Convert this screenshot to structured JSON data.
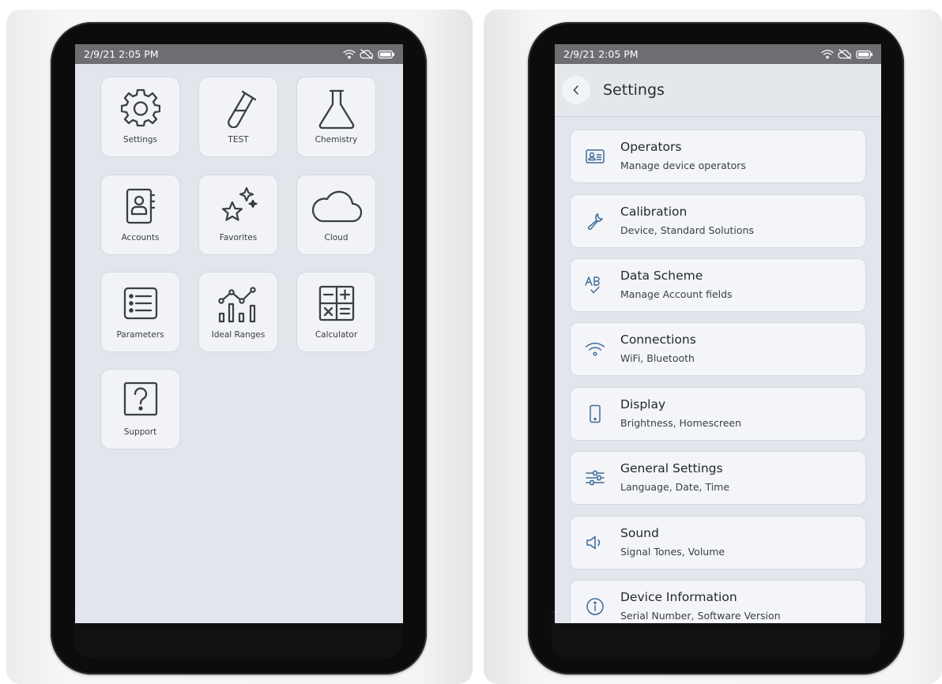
{
  "colors": {
    "accent_blue": "#3d6a96",
    "icon_dark": "#3b3e44",
    "status_bar": "#6c6e72",
    "screen_bg": "#e1e5ec"
  },
  "status_bar": {
    "datetime": "2/9/21 2:05 PM",
    "icons": [
      "wifi-icon",
      "cloud-off-icon",
      "battery-icon"
    ]
  },
  "home": {
    "tiles": [
      {
        "label": "Settings",
        "icon": "gear-icon"
      },
      {
        "label": "TEST",
        "icon": "test-tube-icon"
      },
      {
        "label": "Chemistry",
        "icon": "flask-icon"
      },
      {
        "label": "Accounts",
        "icon": "contact-book-icon"
      },
      {
        "label": "Favorites",
        "icon": "stars-icon"
      },
      {
        "label": "Cloud",
        "icon": "cloud-icon"
      },
      {
        "label": "Parameters",
        "icon": "list-icon"
      },
      {
        "label": "Ideal Ranges",
        "icon": "range-chart-icon"
      },
      {
        "label": "Calculator",
        "icon": "calculator-icon"
      },
      {
        "label": "Support",
        "icon": "question-icon"
      }
    ]
  },
  "settings": {
    "title": "Settings",
    "items": [
      {
        "title": "Operators",
        "subtitle": "Manage device operators",
        "icon": "operator-card-icon"
      },
      {
        "title": "Calibration",
        "subtitle": "Device, Standard Solutions",
        "icon": "wrench-icon"
      },
      {
        "title": "Data Scheme",
        "subtitle": "Manage Account fields",
        "icon": "ab-check-icon"
      },
      {
        "title": "Connections",
        "subtitle": "WiFi, Bluetooth",
        "icon": "wifi-icon"
      },
      {
        "title": "Display",
        "subtitle": "Brightness, Homescreen",
        "icon": "phone-icon"
      },
      {
        "title": "General Settings",
        "subtitle": "Language, Date, Time",
        "icon": "sliders-icon"
      },
      {
        "title": "Sound",
        "subtitle": "Signal Tones, Volume",
        "icon": "speaker-icon"
      },
      {
        "title": "Device Information",
        "subtitle": "Serial Number, Software Version",
        "icon": "info-icon"
      }
    ]
  }
}
